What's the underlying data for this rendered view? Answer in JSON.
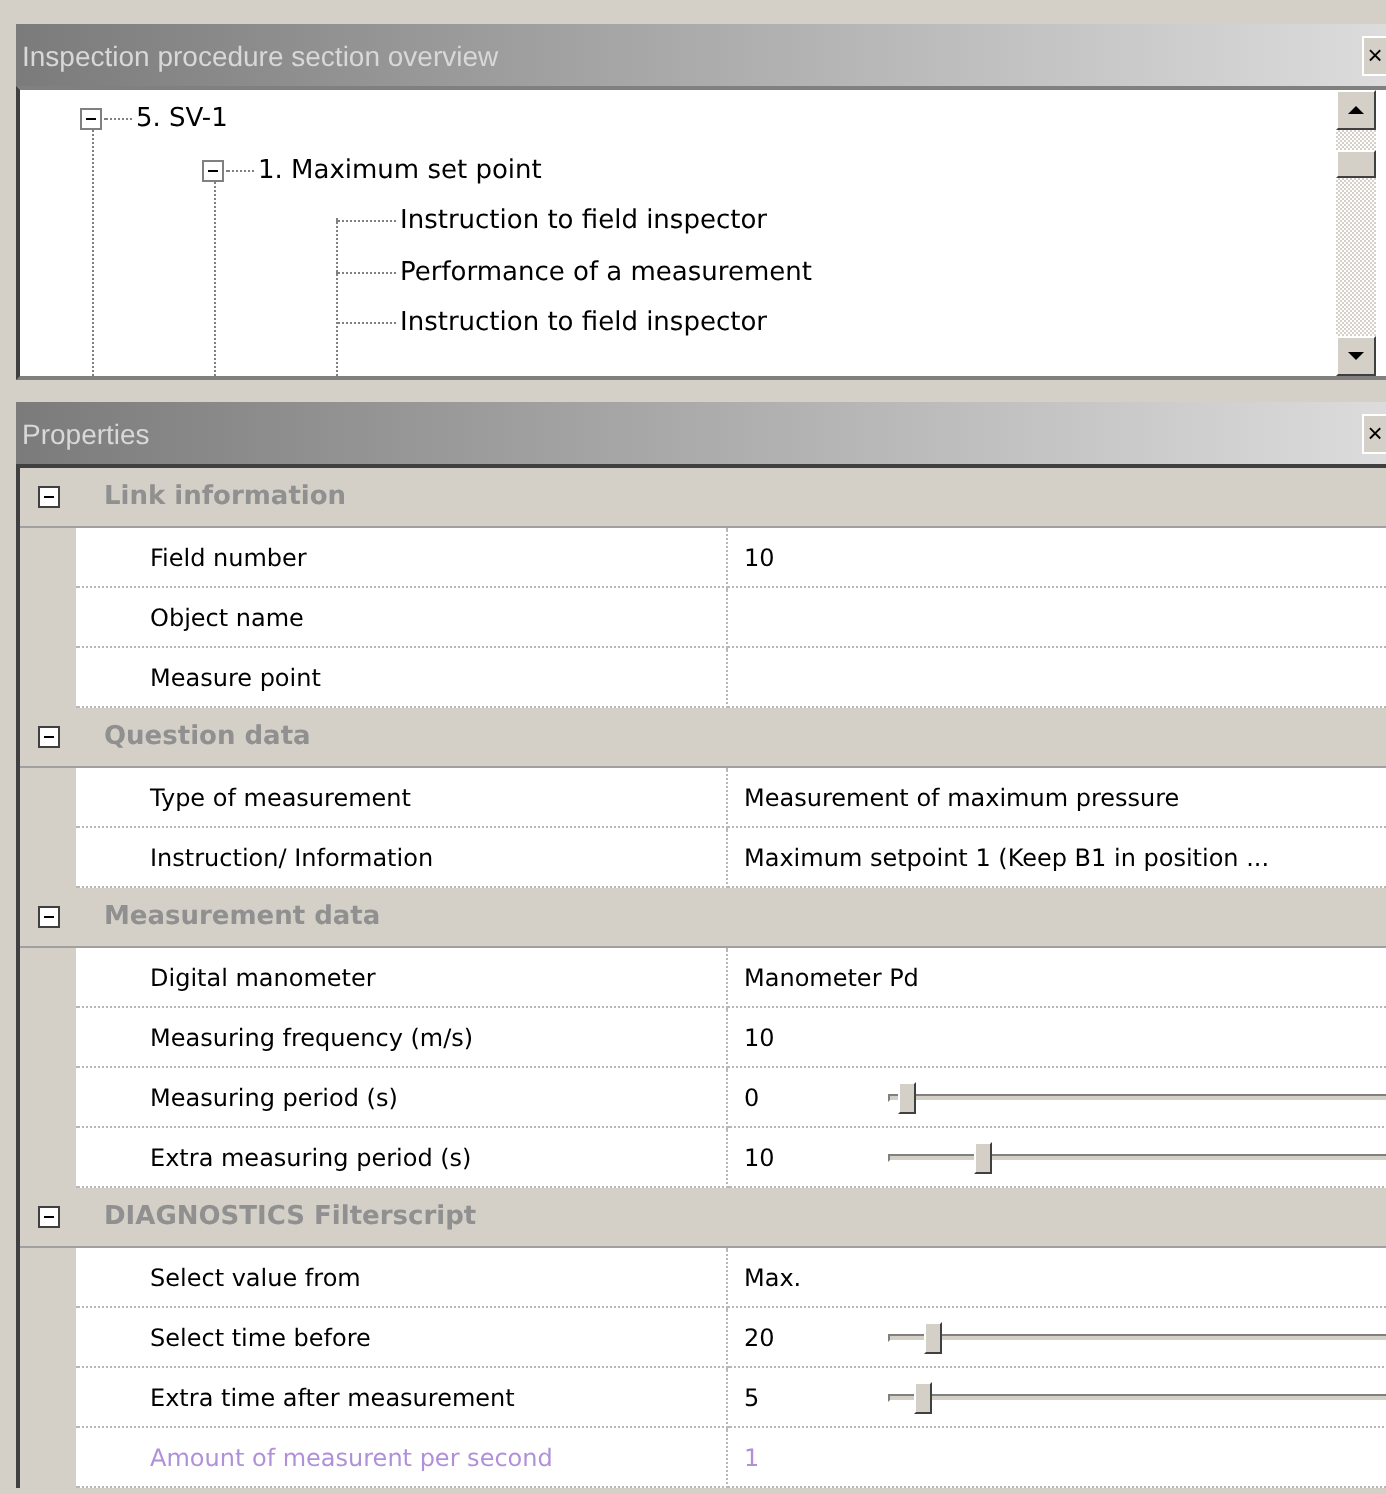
{
  "tree_panel": {
    "title": "Inspection procedure section overview",
    "close": "×",
    "tree": [
      {
        "label": "5. SV-1",
        "expanded": true,
        "children": [
          {
            "label": "1. Maximum set point",
            "expanded": true,
            "children": [
              {
                "label": "Instruction to field inspector"
              },
              {
                "label": "Performance of a measurement"
              },
              {
                "label": "Instruction to field inspector"
              }
            ]
          }
        ]
      }
    ]
  },
  "properties_panel": {
    "title": "Properties",
    "close": "×",
    "categories": [
      {
        "label": "Link information",
        "expanded": true,
        "rows": [
          {
            "name": "Field number",
            "value": "10",
            "kind": "text",
            "disabled": false
          },
          {
            "name": "Object name",
            "kind": "text",
            "disabled": false
          },
          {
            "name": "Measure point",
            "kind": "text",
            "disabled": false
          }
        ]
      },
      {
        "label": "Question data",
        "expanded": true,
        "rows": [
          {
            "name": "Type of measurement",
            "value": "Measurement of maximum pressure",
            "kind": "text",
            "disabled": false
          },
          {
            "name": "Instruction/ Information",
            "value": "Maximum setpoint 1 (Keep B1 in position ...",
            "kind": "text",
            "disabled": false
          }
        ]
      },
      {
        "label": "Measurement data",
        "expanded": true,
        "rows": [
          {
            "name": "Digital manometer",
            "value": "Manometer Pd",
            "kind": "text",
            "disabled": false
          },
          {
            "name": "Measuring frequency (m/s)",
            "value": "10",
            "kind": "text",
            "disabled": false
          },
          {
            "name": "Measuring period (s)",
            "value": "0",
            "kind": "slider",
            "level": 0.02,
            "disabled": false
          },
          {
            "name": "Extra measuring period (s)",
            "value": "10",
            "kind": "slider",
            "level": 0.17,
            "disabled": false
          }
        ]
      },
      {
        "label": "DIAGNOSTICS Filterscript",
        "expanded": true,
        "rows": [
          {
            "name": "Select value from",
            "value": "Max.",
            "kind": "text",
            "disabled": false
          },
          {
            "name": "Select time before",
            "value": "20",
            "kind": "slider",
            "level": 0.07,
            "disabled": false
          },
          {
            "name": "Extra time after measurement",
            "value": "5",
            "kind": "slider",
            "level": 0.05,
            "disabled": false
          },
          {
            "name": "Amount of measurent per second",
            "value": "1",
            "kind": "text",
            "disabled": true
          }
        ]
      }
    ]
  }
}
